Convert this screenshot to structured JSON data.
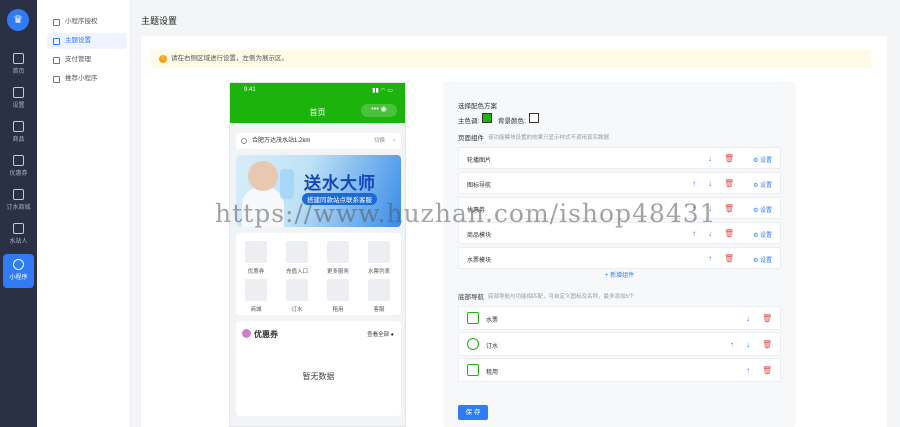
{
  "rail": {
    "items": [
      {
        "label": "首页",
        "icon": "home-icon"
      },
      {
        "label": "设置",
        "icon": "settings-icon"
      },
      {
        "label": "商品",
        "icon": "goods-icon"
      },
      {
        "label": "优惠券",
        "icon": "coupon-icon"
      },
      {
        "label": "订水商城",
        "icon": "mall-icon"
      },
      {
        "label": "水站人",
        "icon": "staff-icon"
      },
      {
        "label": "小程序",
        "icon": "miniprogram-icon"
      }
    ]
  },
  "submenu": [
    {
      "label": "小程序授权",
      "icon": "auth-icon"
    },
    {
      "label": "主题设置",
      "icon": "theme-icon"
    },
    {
      "label": "支付管理",
      "icon": "payment-icon"
    },
    {
      "label": "推荐小程序",
      "icon": "recommend-icon"
    }
  ],
  "page_title": "主题设置",
  "notice": "请在右侧区域进行设置，左侧为展示区。",
  "phone": {
    "time": "9:41",
    "title": "首页",
    "capsule": "••• ◉",
    "address": "合肥万达茂水站1.2km",
    "switch": "切换",
    "banner_title": "送水大师",
    "banner_slogan": "搭建同款站点联系客服",
    "grid": [
      "优惠券",
      "充值入口",
      "更多服务",
      "水票列表",
      "商城",
      "订水",
      "租用",
      "客服"
    ],
    "coupon_title": "优惠券",
    "coupon_more": "查看全部",
    "empty": "暂无数据"
  },
  "config": {
    "scheme_title": "选择配色方案",
    "main_color_label": "主色调:",
    "main_color": "#1db30d",
    "bg_color_label": "背景颜色:",
    "bg_color": "#ffffff",
    "page_components": "页面组件",
    "page_components_hint": "该功能模块设置的效果只显示样式不调用真实数据",
    "components": [
      {
        "name": "轮播图片",
        "up": false,
        "down": true
      },
      {
        "name": "图标导航",
        "up": true,
        "down": true
      },
      {
        "name": "优惠券",
        "up": true,
        "down": true
      },
      {
        "name": "商品模块",
        "up": true,
        "down": true
      },
      {
        "name": "水票模块",
        "up": true,
        "down": false
      }
    ],
    "set_label": "设置",
    "add_component": "+ 新增组件",
    "bottom_nav": "底部导航",
    "bottom_nav_hint": "底部导航与功能相匹配，可自定义图标及名称，最多添加5个",
    "nav_items": [
      {
        "name": "水票",
        "up": false,
        "down": true
      },
      {
        "name": "订水",
        "up": true,
        "down": true
      },
      {
        "name": "租用",
        "up": true,
        "down": false
      }
    ],
    "save": "保 存"
  },
  "watermark": "https://www.huzhan.com/ishop48431"
}
